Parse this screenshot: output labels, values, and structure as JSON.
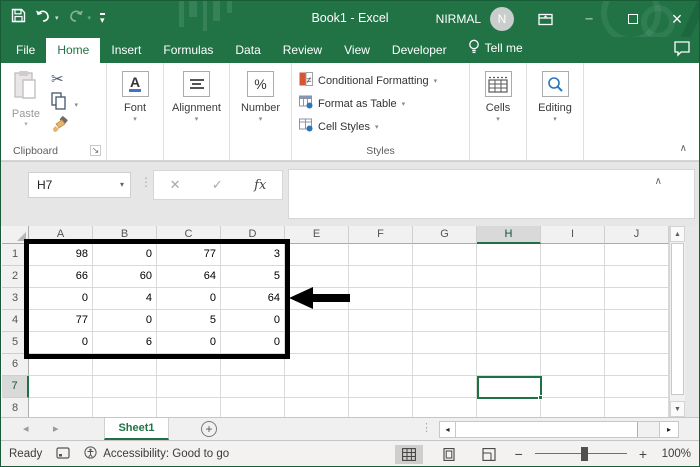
{
  "title_bar": {
    "title": "Book1 - Excel",
    "user": "NIRMAL",
    "avatar_initial": "N"
  },
  "tabs": [
    {
      "label": "File"
    },
    {
      "label": "Home"
    },
    {
      "label": "Insert"
    },
    {
      "label": "Formulas"
    },
    {
      "label": "Data"
    },
    {
      "label": "Review"
    },
    {
      "label": "View"
    },
    {
      "label": "Developer"
    },
    {
      "label": "Tell me"
    }
  ],
  "active_tab": "Home",
  "ribbon": {
    "paste_label": "Paste",
    "clipboard_group": "Clipboard",
    "font_group": "Font",
    "font_icon_letter": "A",
    "alignment_group": "Alignment",
    "number_group": "Number",
    "number_icon": "%",
    "styles_items": [
      {
        "label": "Conditional Formatting"
      },
      {
        "label": "Format as Table"
      },
      {
        "label": "Cell Styles"
      }
    ],
    "styles_group": "Styles",
    "cells_group": "Cells",
    "editing_group": "Editing"
  },
  "formula_bar": {
    "name_box_value": "H7",
    "fx_label": "fx"
  },
  "grid": {
    "columns": [
      "A",
      "B",
      "C",
      "D",
      "E",
      "F",
      "G",
      "H",
      "I",
      "J"
    ],
    "row_numbers": [
      "1",
      "2",
      "3",
      "4",
      "5",
      "6",
      "7",
      "8"
    ],
    "data": [
      [
        98,
        0,
        77,
        3
      ],
      [
        66,
        60,
        64,
        5
      ],
      [
        0,
        4,
        0,
        64
      ],
      [
        77,
        0,
        5,
        0
      ],
      [
        0,
        6,
        0,
        0
      ]
    ],
    "selected_cell": "H7",
    "selected_column": "H",
    "selected_row": "7",
    "annotations": {
      "thick_border_range": "A1:D5",
      "arrow_points_at": "D3"
    }
  },
  "sheet_bar": {
    "sheet_name": "Sheet1"
  },
  "status_bar": {
    "mode": "Ready",
    "accessibility": "Accessibility: Good to go",
    "zoom_level": "100%"
  },
  "icons": {
    "dropdown_caret": "▾",
    "scissors": "✂",
    "cancel": "✕",
    "check": "✓",
    "collapse_ribbon": "∧",
    "formula_collapse": "∧",
    "vertical_dots": "⋮",
    "dialog_launcher": "↘",
    "left_triangle": "◂",
    "right_triangle": "▸",
    "up_triangle": "▲",
    "down_triangle": "▼",
    "minimize": "─",
    "close": "×",
    "plus": "+",
    "minus": "−"
  },
  "colors": {
    "excel_green": "#217346",
    "selection_green": "#1E7145",
    "annotation_black": "#000000"
  }
}
